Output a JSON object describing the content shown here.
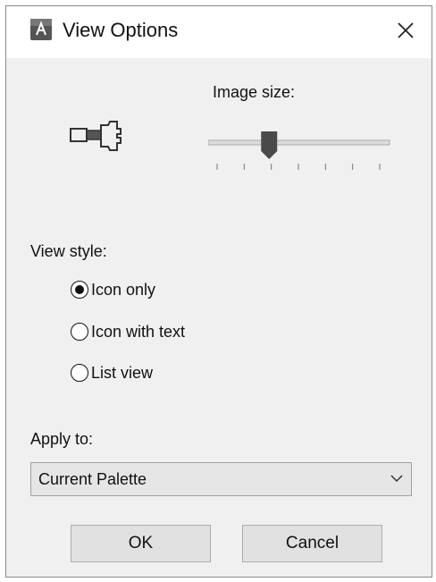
{
  "window": {
    "title": "View Options",
    "app_icon": "autocad-app-icon",
    "close_icon": "close-icon"
  },
  "image_size": {
    "label": "Image size:",
    "preview_icon": "shaft-preview-icon",
    "slider_level": 0.32,
    "tick_count": 7
  },
  "view_style": {
    "label": "View style:",
    "options": [
      {
        "label": "Icon only",
        "selected": true
      },
      {
        "label": "Icon with text",
        "selected": false
      },
      {
        "label": "List view",
        "selected": false
      }
    ]
  },
  "apply_to": {
    "label": "Apply to:",
    "selected": "Current Palette",
    "arrow_icon": "chevron-down-icon"
  },
  "buttons": {
    "ok": "OK",
    "cancel": "Cancel"
  }
}
